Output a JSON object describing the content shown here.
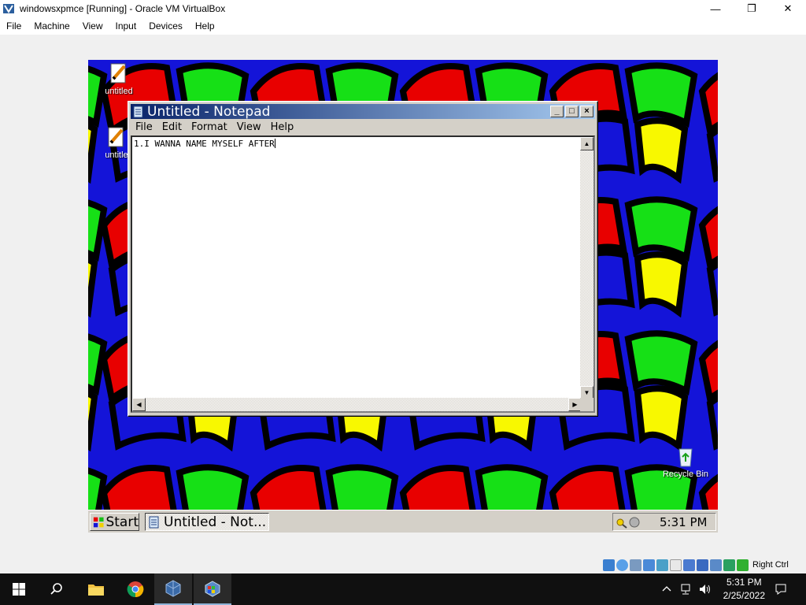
{
  "host_window": {
    "title": "windowsxpmce [Running] - Oracle VM VirtualBox",
    "controls": {
      "minimize": "—",
      "restore": "❐",
      "close": "✕"
    }
  },
  "host_menu": [
    "File",
    "Machine",
    "View",
    "Input",
    "Devices",
    "Help"
  ],
  "guest": {
    "desktop_icons": [
      {
        "label": "untitled",
        "icon": "notepad-file-icon"
      },
      {
        "label": "untitle",
        "icon": "notepad-file-icon"
      },
      {
        "label": "Recycle Bin",
        "icon": "recycle-bin-icon"
      }
    ],
    "notepad": {
      "title": "Untitled - Notepad",
      "menu": [
        "File",
        "Edit",
        "Format",
        "View",
        "Help"
      ],
      "content": "1.I WANNA NAME MYSELF AFTER",
      "controls": {
        "minimize": "_",
        "maximize": "□",
        "close": "×"
      }
    },
    "taskbar": {
      "start_label": "Start",
      "task_label": "Untitled - Not...",
      "clock": "5:31 PM"
    },
    "wallpaper_colors": {
      "background": "#1414d8",
      "red": "#e80000",
      "green": "#16e016",
      "yellow": "#f8f800",
      "outline": "#000000"
    }
  },
  "vbox_status": {
    "host_key": "Right Ctrl"
  },
  "host_taskbar": {
    "time": "5:31 PM",
    "date": "2/25/2022",
    "pinned": [
      "start-windows-icon",
      "search-icon",
      "file-explorer-icon",
      "chrome-icon",
      "virtualbox-icon",
      "windowsxp-vm-icon"
    ]
  }
}
